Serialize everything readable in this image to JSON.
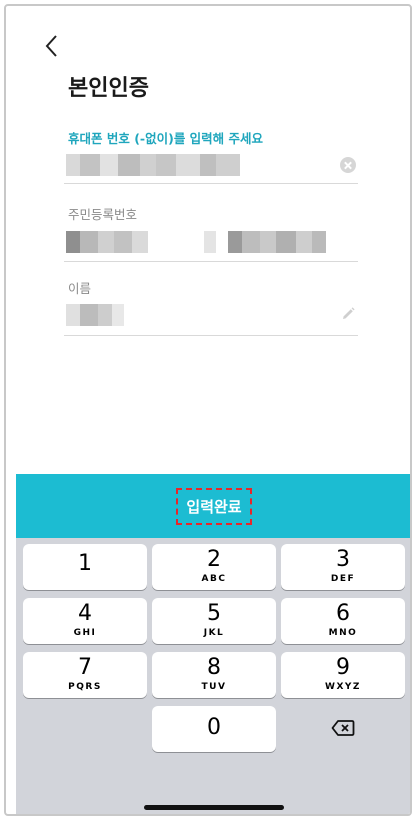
{
  "header": {
    "title": "본인인증"
  },
  "phone": {
    "label": "휴대폰 번호 (-없이)를 입력해 주세요"
  },
  "resident": {
    "label": "주민등록번호"
  },
  "name": {
    "label": "이름"
  },
  "submit": {
    "label": "입력완료"
  },
  "keypad": {
    "keys": [
      {
        "num": "1",
        "letters": ""
      },
      {
        "num": "2",
        "letters": "ABC"
      },
      {
        "num": "3",
        "letters": "DEF"
      },
      {
        "num": "4",
        "letters": "GHI"
      },
      {
        "num": "5",
        "letters": "JKL"
      },
      {
        "num": "6",
        "letters": "MNO"
      },
      {
        "num": "7",
        "letters": "PQRS"
      },
      {
        "num": "8",
        "letters": "TUV"
      },
      {
        "num": "9",
        "letters": "WXYZ"
      },
      {
        "num": "0",
        "letters": ""
      }
    ],
    "delete_icon": "backspace-icon"
  },
  "colors": {
    "accent": "#1cbcd2",
    "label_active": "#1fa6bd",
    "highlight": "#e8262a",
    "keypad_bg": "#d2d4da"
  }
}
